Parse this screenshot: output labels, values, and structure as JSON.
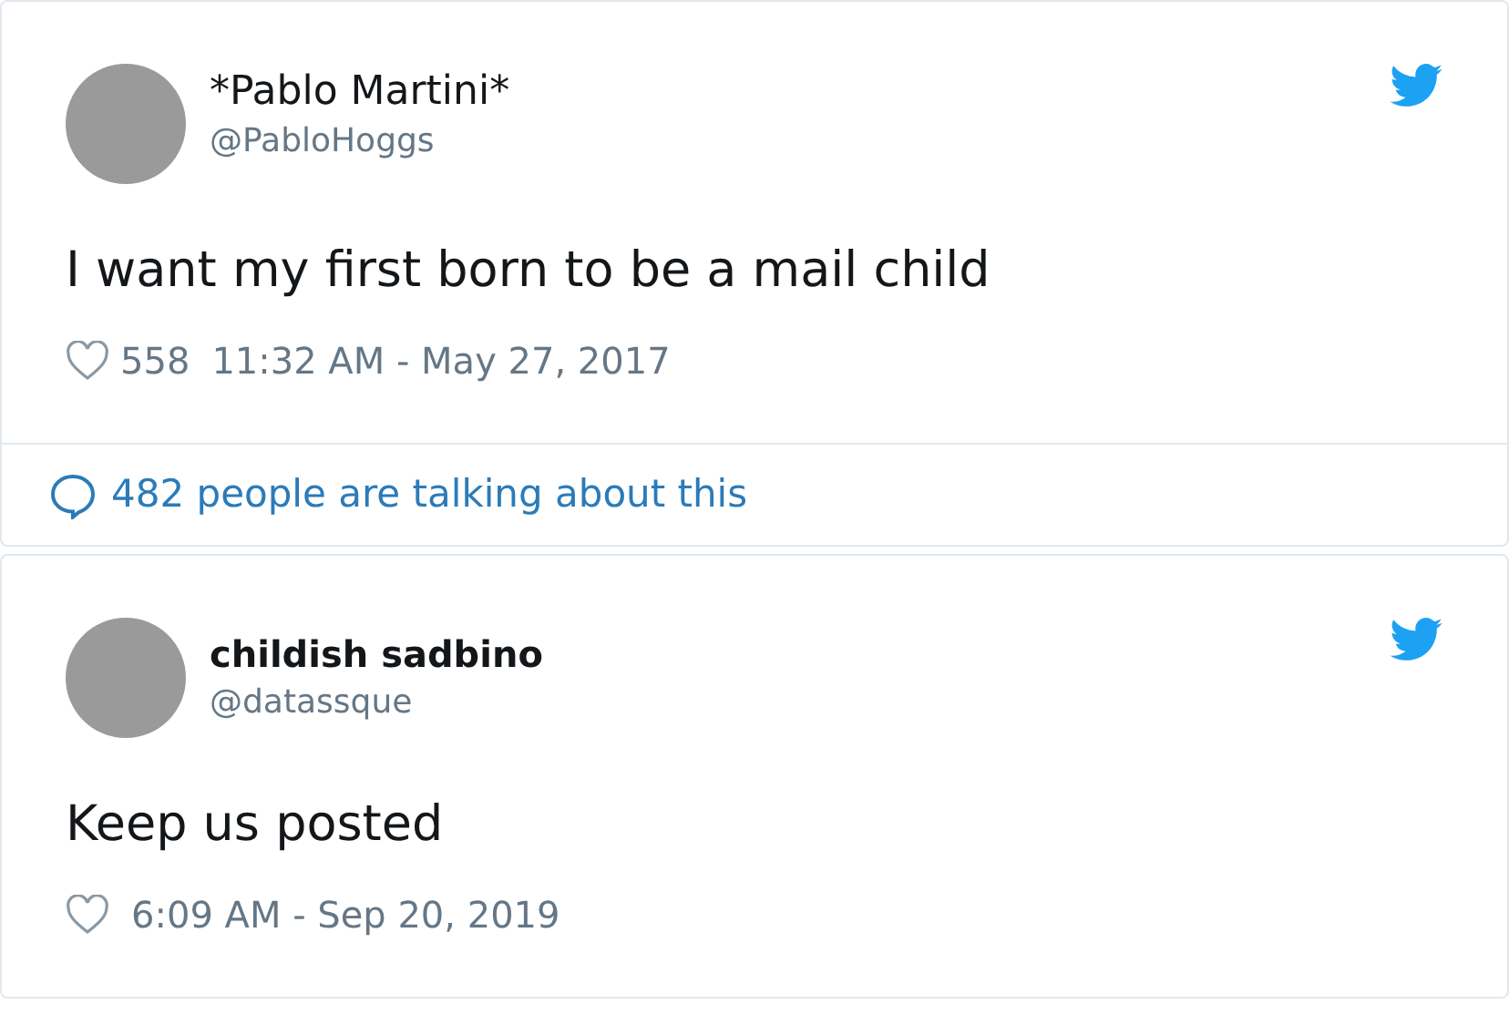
{
  "tweets": [
    {
      "name": "*Pablo Martini*",
      "name_bold": false,
      "handle": "@PabloHoggs",
      "text": "I want my first born to be a mail child",
      "likes": "558",
      "timestamp": "11:32 AM - May 27, 2017",
      "discussion": "482 people are talking about this"
    },
    {
      "name": "childish sadbino",
      "name_bold": true,
      "handle": "@datassque",
      "text": "Keep us posted",
      "timestamp": "6:09 AM - Sep 20, 2019"
    }
  ]
}
